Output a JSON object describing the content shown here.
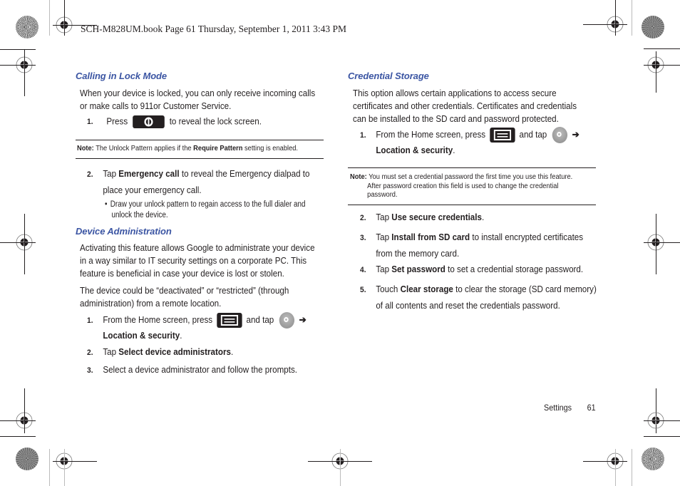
{
  "header": {
    "print_slug": "SCH-M828UM.book  Page 61  Thursday, September 1, 2011  3:43 PM"
  },
  "left_column": {
    "calling_lock": {
      "title": "Calling in Lock Mode",
      "intro_line1": "When your device is locked, you can only receive incoming calls",
      "intro_line2": "or make calls to 911or Customer Service.",
      "step1": {
        "num": "1.",
        "pre": "Press",
        "post": "to reveal the lock screen.",
        "icon": "power-lock-key-icon"
      },
      "note": {
        "label": "Note:",
        "pre": " The Unlock Pattern applies if the ",
        "bold": "Require Pattern",
        "post": " setting is enabled."
      },
      "step2": {
        "num": "2.",
        "pre": "Tap ",
        "bold": "Emergency call",
        "post": " to reveal the Emergency dialpad to",
        "line2": "place your emergency call."
      },
      "bullet": {
        "glyph": "•",
        "line1": "Draw your unlock pattern to regain access to the full dialer and",
        "line2": "unlock the device."
      }
    },
    "device_admin": {
      "title": "Device Administration",
      "para1_line1": "Activating this feature allows Google to administrate your device",
      "para1_line2": "in a way similar to IT security settings on a corporate PC. This",
      "para1_line3": "feature is beneficial in case your device is lost or stolen.",
      "para2_line1": "The device could be “deactivated” or “restricted” (through",
      "para2_line2": "administration) from a remote location.",
      "step1": {
        "num": "1.",
        "pre": "From the Home screen, press",
        "mid": "and tap",
        "arrow": "➔",
        "bold": "Location & security",
        "post": "."
      },
      "step2": {
        "num": "2.",
        "pre": "Tap ",
        "bold": "Select device administrators",
        "post": "."
      },
      "step3": {
        "num": "3.",
        "text": "Select a device administrator and follow the prompts."
      }
    }
  },
  "right_column": {
    "credential": {
      "title": "Credential Storage",
      "para_line1": "This option allows certain applications to access secure",
      "para_line2": "certificates and other credentials. Certificates and credentials",
      "para_line3": "can be installed to the SD card and password protected.",
      "step1": {
        "num": "1.",
        "pre": "From the Home screen, press",
        "mid": "and tap",
        "arrow": "➔",
        "bold": "Location & security",
        "post": "."
      },
      "note": {
        "label": "Note:",
        "line1": " You must set a credential password the first time you use this feature.",
        "line2": "After password creation this field is used to change the credential",
        "line3": "password."
      },
      "step2": {
        "num": "2.",
        "pre": "Tap ",
        "bold": "Use secure credentials",
        "post": "."
      },
      "step3": {
        "num": "3.",
        "pre": "Tap ",
        "bold": "Install from SD card",
        "post": " to install encrypted certificates",
        "line2": "from the memory card."
      },
      "step4": {
        "num": "4.",
        "pre": "Tap ",
        "bold": "Set password",
        "post": " to set a credential storage password."
      },
      "step5": {
        "num": "5.",
        "pre": "Touch ",
        "bold": "Clear storage",
        "post": " to clear the storage (SD card memory)",
        "line2": "of all contents and reset the credentials password."
      }
    }
  },
  "footer": {
    "section": "Settings",
    "page_number": "61"
  }
}
